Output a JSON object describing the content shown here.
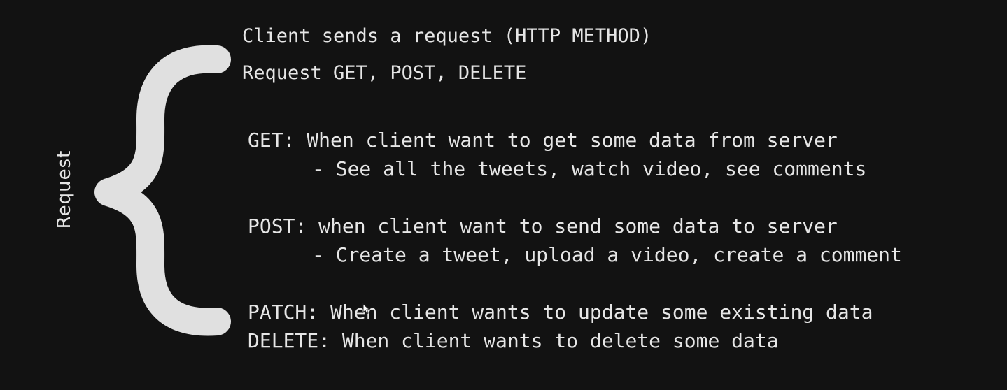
{
  "side_label": "Request",
  "header": {
    "line1": "Client sends a request (HTTP METHOD)",
    "line2": "Request GET, POST, DELETE"
  },
  "methods": {
    "get": {
      "line": "GET: When client want to get some data from server",
      "example": "- See all the tweets, watch video, see comments"
    },
    "post": {
      "line": "POST: when client want to send some data to server",
      "example": "- Create a tweet, upload a video, create a comment"
    },
    "patch": {
      "line": "PATCH: When client wants to update some existing data"
    },
    "delete": {
      "line": "DELETE: When client wants to delete some data"
    }
  },
  "colors": {
    "background": "#121212",
    "text": "#e6e6e6",
    "brace": "#e0e0e0"
  }
}
